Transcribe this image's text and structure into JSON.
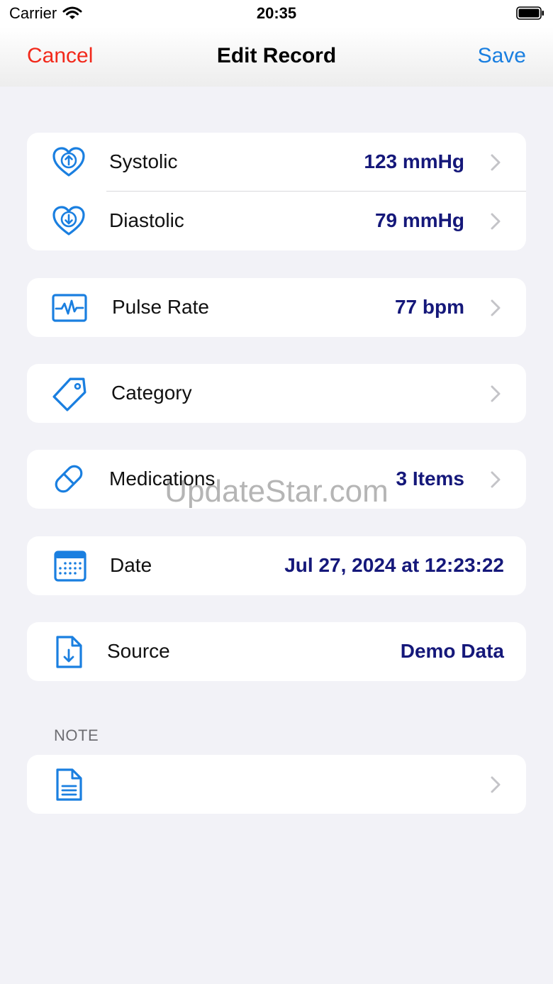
{
  "status_bar": {
    "carrier": "Carrier",
    "time": "20:35"
  },
  "nav": {
    "cancel": "Cancel",
    "title": "Edit Record",
    "save": "Save"
  },
  "rows": {
    "systolic": {
      "label": "Systolic",
      "value": "123 mmHg",
      "icon": "heart-up-icon"
    },
    "diastolic": {
      "label": "Diastolic",
      "value": "79 mmHg",
      "icon": "heart-down-icon"
    },
    "pulse": {
      "label": "Pulse Rate",
      "value": "77 bpm",
      "icon": "pulse-wave-icon"
    },
    "category": {
      "label": "Category",
      "value": "",
      "icon": "tag-icon"
    },
    "medications": {
      "label": "Medications",
      "value": "3 Items",
      "icon": "pill-icon"
    },
    "date": {
      "label": "Date",
      "value": "Jul 27, 2024 at 12:23:22",
      "icon": "calendar-icon"
    },
    "source": {
      "label": "Source",
      "value": "Demo Data",
      "icon": "document-download-icon"
    }
  },
  "note": {
    "header": "NOTE",
    "icon": "note-document-icon"
  },
  "watermark": "UpdateStar.com",
  "colors": {
    "accent": "#1A7FE0",
    "cancel": "#F2291B",
    "value": "#15187A",
    "icon": "#1A7FE0"
  }
}
